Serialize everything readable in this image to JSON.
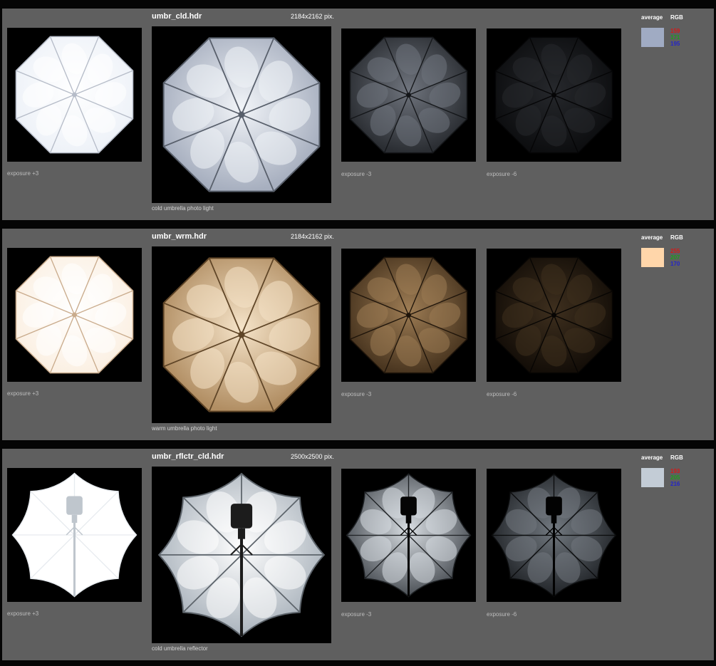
{
  "entries": [
    {
      "filename": "umbr_cld.hdr",
      "dimensions": "2184x2162 pix.",
      "description": "cold umbrella photo light",
      "caption_plus3": "exposure +3",
      "caption_minus3": "exposure -3",
      "caption_minus6": "exposure -6",
      "average_label": "average",
      "rgb_label": "RGB",
      "swatch_color": "#a0abc3",
      "rgb": {
        "r": "159",
        "g": "171",
        "b": "195"
      },
      "kind": "umbrella",
      "tones": {
        "plus3": {
          "base": "#eef2f8",
          "hi": "#ffffff",
          "rib": "#b6bcc8"
        },
        "main": {
          "base": "#a7afbf",
          "hi": "#f1f4f8",
          "rib": "#585f6b"
        },
        "minus3": {
          "base": "#2b2e33",
          "hi": "#6f747d",
          "rib": "#141619"
        },
        "minus6": {
          "base": "#0d0e10",
          "hi": "#26282c",
          "rib": "#050506"
        }
      }
    },
    {
      "filename": "umbr_wrm.hdr",
      "dimensions": "2184x2162 pix.",
      "description": "warm umbrella photo light",
      "caption_plus3": "exposure +3",
      "caption_minus3": "exposure -3",
      "caption_minus6": "exposure -6",
      "average_label": "average",
      "rgb_label": "RGB",
      "swatch_color": "#ffd6aa",
      "rgb": {
        "r": "255",
        "g": "207",
        "b": "170"
      },
      "kind": "umbrella",
      "tones": {
        "plus3": {
          "base": "#fbf0e3",
          "hi": "#ffffff",
          "rib": "#c9ab8c"
        },
        "main": {
          "base": "#b18e63",
          "hi": "#f5e3c8",
          "rib": "#5f4527"
        },
        "minus3": {
          "base": "#4a3620",
          "hi": "#9d7c54",
          "rib": "#1e140a"
        },
        "minus6": {
          "base": "#140e08",
          "hi": "#3e2f1e",
          "rib": "#070503"
        }
      }
    },
    {
      "filename": "umbr_rflctr_cld.hdr",
      "dimensions": "2500x2500 pix.",
      "description": "cold umbrella reflector",
      "caption_plus3": "exposure +3",
      "caption_minus3": "exposure -3",
      "caption_minus6": "exposure -6",
      "average_label": "average",
      "rgb_label": "RGB",
      "swatch_color": "#c3ccd6",
      "rgb": {
        "r": "193",
        "g": "205",
        "b": "216"
      },
      "kind": "reflector",
      "tones": {
        "plus3": {
          "base": "#ffffff",
          "hi": "#ffffff",
          "rib": "#e7ebef",
          "stand": "#bfc6cd"
        },
        "main": {
          "base": "#aab3bc",
          "hi": "#ffffff",
          "rib": "#5d646b",
          "stand": "#1c1c1c"
        },
        "minus3": {
          "base": "#4a4f55",
          "hi": "#d9dee3",
          "rib": "#1e2124",
          "stand": "#050505"
        },
        "minus6": {
          "base": "#202327",
          "hi": "#727980",
          "rib": "#0b0c0d",
          "stand": "#020202"
        }
      }
    }
  ]
}
